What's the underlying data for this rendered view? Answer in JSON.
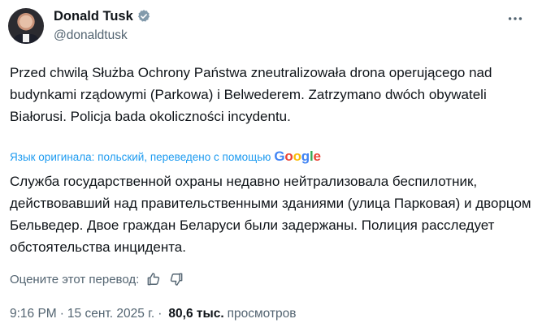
{
  "author": {
    "display_name": "Donald Tusk",
    "handle": "@donaldtusk"
  },
  "tweet": {
    "text": "Przed chwilą Służba Ochrony Państwa zneutralizowała drona operującego nad budynkami rządowymi (Parkowa) i Belwederem. Zatrzymano dwóch obywateli Białorusi. Policja bada okoliczności incydentu.",
    "translation_notice": "Язык оригинала: польский, переведено с помощью",
    "translation_provider": "Google",
    "translated_text": "Служба государственной охраны недавно нейтрализовала беспилотник, действовавший над правительственными зданиями (улица Парковая) и дворцом Бельведер. Двое граждан Беларуси были задержаны. Полиция расследует обстоятельства инцидента.",
    "rate_label": "Оцените этот перевод:"
  },
  "meta": {
    "time": "9:16 PM",
    "separator1": "·",
    "date": "15 сент. 2025 г.",
    "separator2": "·",
    "views_count": "80,6 тыс.",
    "views_label": "просмотров"
  },
  "icons": {
    "verified": "verified-badge-icon",
    "more": "more-options-icon",
    "thumbs_up": "thumbs-up-icon",
    "thumbs_down": "thumbs-down-icon"
  },
  "colors": {
    "link_blue": "#1d9bf0",
    "secondary_text": "#536471",
    "primary_text": "#0f1419"
  }
}
